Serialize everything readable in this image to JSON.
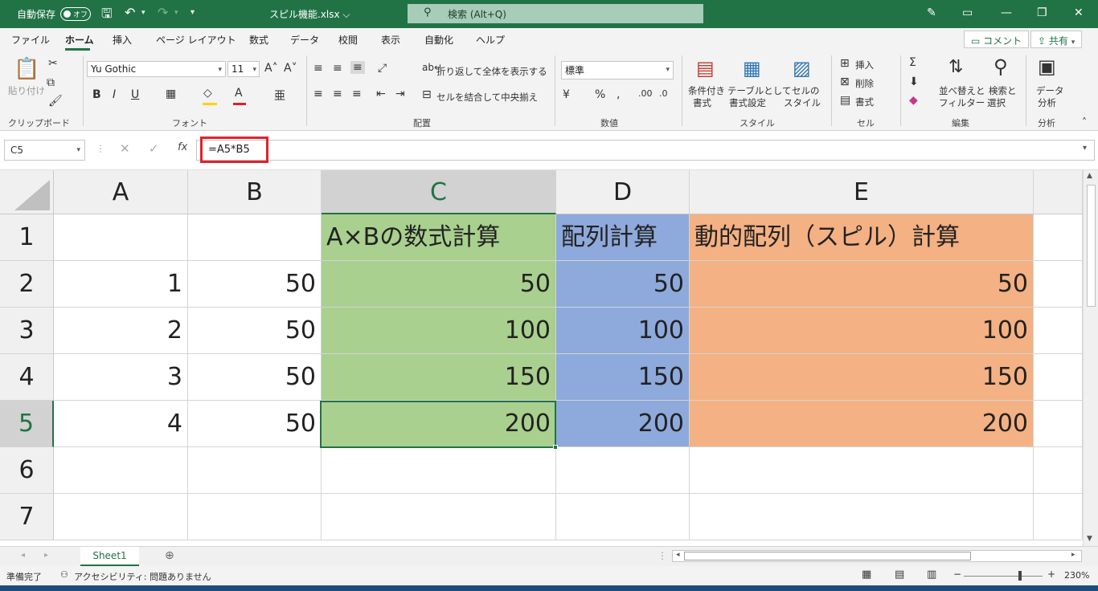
{
  "titlebar": {
    "autosave_label": "自動保存",
    "autosave_state": "オフ",
    "filename": "スピル機能.xlsx ⌵",
    "search_placeholder": "検索 (Alt+Q)"
  },
  "menu": {
    "tabs": [
      "ファイル",
      "ホーム",
      "挿入",
      "ページ レイアウト",
      "数式",
      "データ",
      "校閲",
      "表示",
      "自動化",
      "ヘルプ"
    ],
    "comment_label": "コメント",
    "share_label": "共有"
  },
  "ribbon": {
    "paste_label": "貼り付け",
    "font_name": "Yu Gothic",
    "font_size": "11",
    "wrap_text": "折り返して全体を表示する",
    "merge_center": "セルを結合して中央揃え",
    "number_format": "標準",
    "cond_format_1": "条件付き",
    "cond_format_2": "書式",
    "table_format_1": "テーブルとして",
    "table_format_2": "書式設定",
    "cell_style_1": "セルの",
    "cell_style_2": "スタイル",
    "insert": "挿入",
    "delete": "削除",
    "format": "書式",
    "sort_filter_1": "並べ替えと",
    "sort_filter_2": "フィルター",
    "find_select_1": "検索と",
    "find_select_2": "選択",
    "analyze_1": "データ",
    "analyze_2": "分析",
    "groups": {
      "clipboard": "クリップボード",
      "font": "フォント",
      "alignment": "配置",
      "number": "数値",
      "styles": "スタイル",
      "cells": "セル",
      "editing": "編集",
      "analysis": "分析"
    }
  },
  "formula_bar": {
    "name_box": "C5",
    "formula": "=A5*B5"
  },
  "grid": {
    "columns": [
      "A",
      "B",
      "C",
      "D",
      "E"
    ],
    "rows": [
      "1",
      "2",
      "3",
      "4",
      "5",
      "6",
      "7"
    ],
    "header_row": {
      "C": "A×Bの数式計算",
      "D": "配列計算",
      "E": "動的配列（スピル）計算"
    },
    "data_rows": [
      {
        "A": "1",
        "B": "50",
        "C": "50",
        "D": "50",
        "E": "50"
      },
      {
        "A": "2",
        "B": "50",
        "C": "100",
        "D": "100",
        "E": "100"
      },
      {
        "A": "3",
        "B": "50",
        "C": "150",
        "D": "150",
        "E": "150"
      },
      {
        "A": "4",
        "B": "50",
        "C": "200",
        "D": "200",
        "E": "200"
      }
    ],
    "fill_colors": {
      "C": "#a9d08e",
      "D": "#8ea9db",
      "E": "#f4b183"
    }
  },
  "sheets": {
    "active": "Sheet1"
  },
  "status": {
    "ready": "準備完了",
    "accessibility": "アクセシビリティ: 問題ありません",
    "zoom": "230%"
  }
}
